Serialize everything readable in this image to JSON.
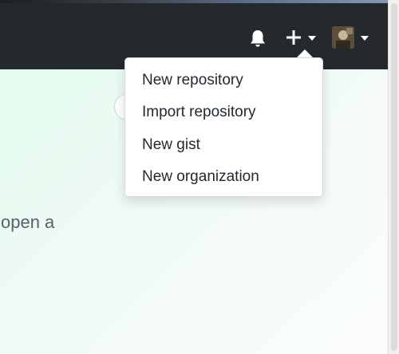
{
  "header": {
    "icons": [
      "bell-icon",
      "plus-icon",
      "caret-down-icon",
      "avatar"
    ]
  },
  "create_menu": {
    "items": [
      {
        "label": "New repository"
      },
      {
        "label": "Import repository"
      },
      {
        "label": "New gist"
      },
      {
        "label": "New organization"
      }
    ]
  },
  "content": {
    "partial_text": "open a"
  },
  "colors": {
    "header_bg": "#24292e",
    "icon_color": "#ffffff",
    "menu_text": "#24292e",
    "content_text": "#586069"
  }
}
